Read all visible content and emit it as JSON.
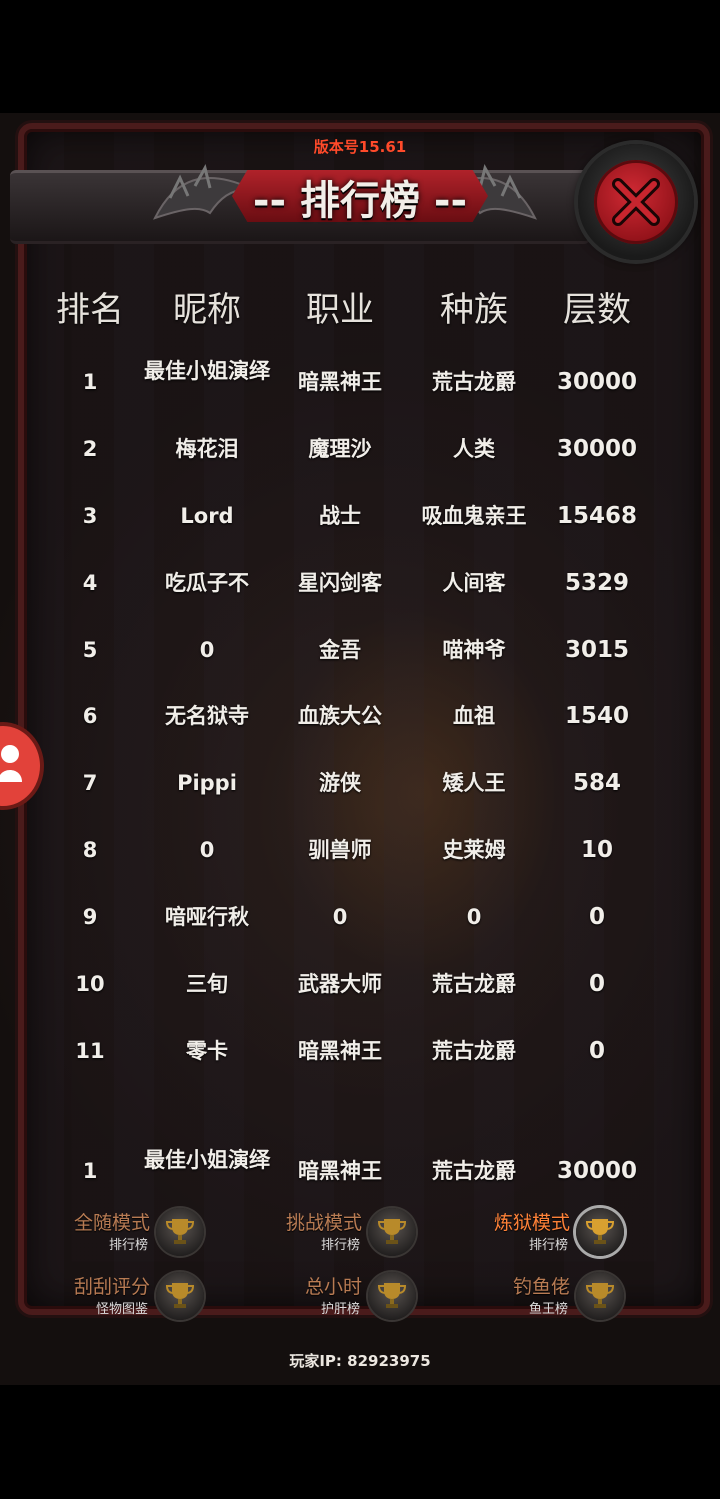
{
  "version": "版本号15.61",
  "title": "-- 排行榜 --",
  "headers": [
    "排名",
    "昵称",
    "职业",
    "种族",
    "层数"
  ],
  "rows": [
    {
      "rank": "1",
      "name": "最佳小姐演绎",
      "job": "暗黑神王",
      "race": "荒古龙爵",
      "floors": "30000"
    },
    {
      "rank": "2",
      "name": "梅花泪",
      "job": "魔理沙",
      "race": "人类",
      "floors": "30000"
    },
    {
      "rank": "3",
      "name": "Lord",
      "job": "战士",
      "race": "吸血鬼亲王",
      "floors": "15468"
    },
    {
      "rank": "4",
      "name": "吃瓜子不",
      "job": "星闪剑客",
      "race": "人间客",
      "floors": "5329"
    },
    {
      "rank": "5",
      "name": "0",
      "job": "金吾",
      "race": "喵神爷",
      "floors": "3015"
    },
    {
      "rank": "6",
      "name": "无名狱寺",
      "job": "血族大公",
      "race": "血祖",
      "floors": "1540"
    },
    {
      "rank": "7",
      "name": "Pippi",
      "job": "游侠",
      "race": "矮人王",
      "floors": "584"
    },
    {
      "rank": "8",
      "name": "0",
      "job": "驯兽师",
      "race": "史莱姆",
      "floors": "10"
    },
    {
      "rank": "9",
      "name": "喑哑行秋",
      "job": "0",
      "race": "0",
      "floors": "0"
    },
    {
      "rank": "10",
      "name": "三旬",
      "job": "武器大师",
      "race": "荒古龙爵",
      "floors": "0"
    },
    {
      "rank": "11",
      "name": "零卡",
      "job": "暗黑神王",
      "race": "荒古龙爵",
      "floors": "0"
    }
  ],
  "self_row": {
    "rank": "1",
    "name": "最佳小姐演绎",
    "job": "暗黑神王",
    "race": "荒古龙爵",
    "floors": "30000"
  },
  "modes": [
    {
      "name": "全随模式",
      "sub": "排行榜",
      "active": false
    },
    {
      "name": "挑战模式",
      "sub": "排行榜",
      "active": false
    },
    {
      "name": "炼狱模式",
      "sub": "排行榜",
      "active": true
    },
    {
      "name": "刮刮评分",
      "sub": "怪物图鉴",
      "active": false
    },
    {
      "name": "总小时",
      "sub": "护肝榜",
      "active": false
    },
    {
      "name": "钓鱼佬",
      "sub": "鱼王榜",
      "active": false
    }
  ],
  "player_ip": "玩家IP:  82923975",
  "icons": {
    "close": "close-icon",
    "avatar": "user-icon",
    "trophy": "trophy-icon"
  }
}
